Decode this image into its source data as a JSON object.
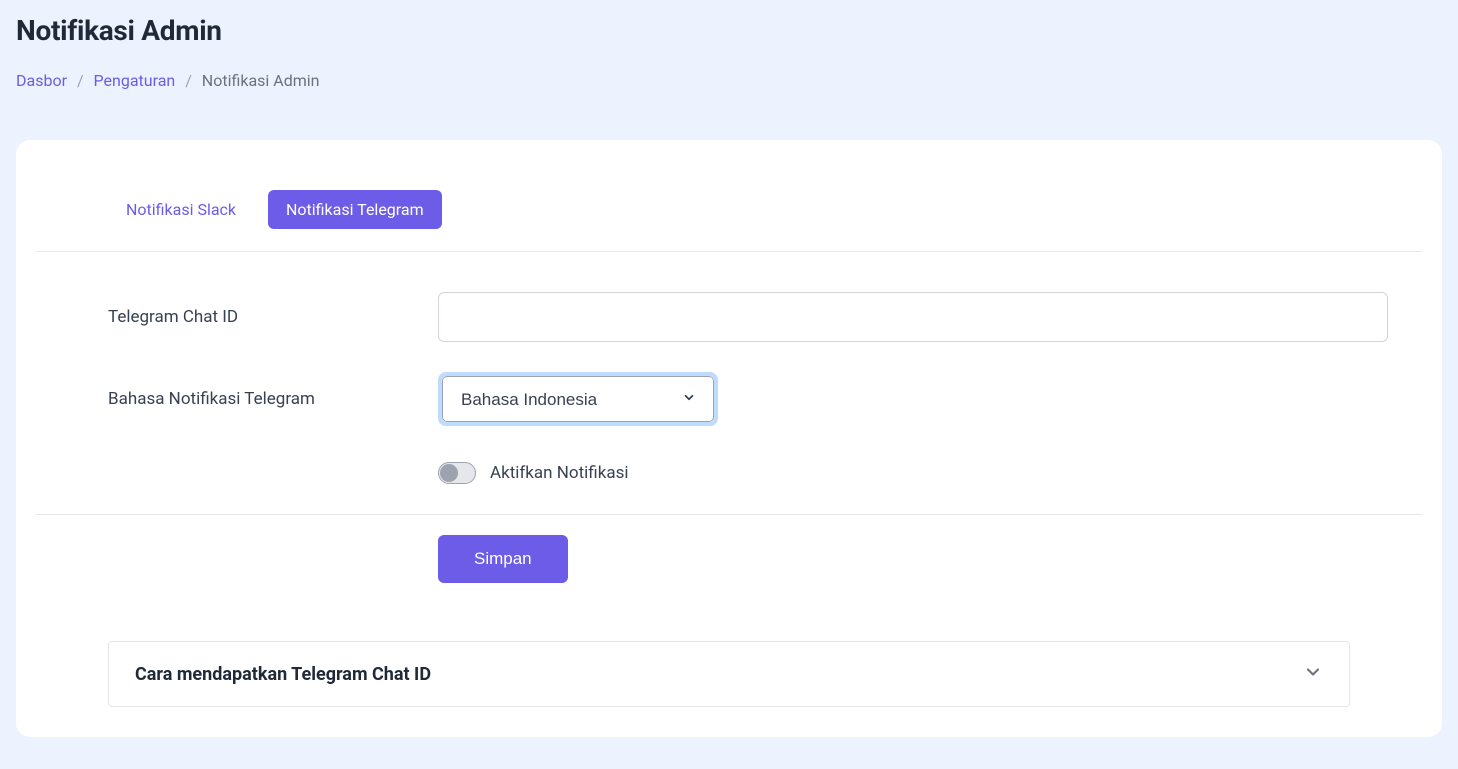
{
  "header": {
    "title": "Notifikasi Admin"
  },
  "breadcrumb": {
    "items": [
      {
        "label": "Dasbor",
        "link": true
      },
      {
        "label": "Pengaturan",
        "link": true
      },
      {
        "label": "Notifikasi Admin",
        "link": false
      }
    ]
  },
  "tabs": [
    {
      "label": "Notifikasi Slack",
      "active": false
    },
    {
      "label": "Notifikasi Telegram",
      "active": true
    }
  ],
  "form": {
    "chat_id_label": "Telegram Chat ID",
    "chat_id_value": "",
    "language_label": "Bahasa Notifikasi Telegram",
    "language_selected": "Bahasa Indonesia",
    "enable_label": "Aktifkan Notifikasi",
    "enable_value": false,
    "submit_label": "Simpan"
  },
  "accordion": {
    "title": "Cara mendapatkan Telegram Chat ID",
    "expanded": false
  },
  "colors": {
    "primary": "#6c5ce7",
    "page_bg": "#ecf3fe"
  }
}
